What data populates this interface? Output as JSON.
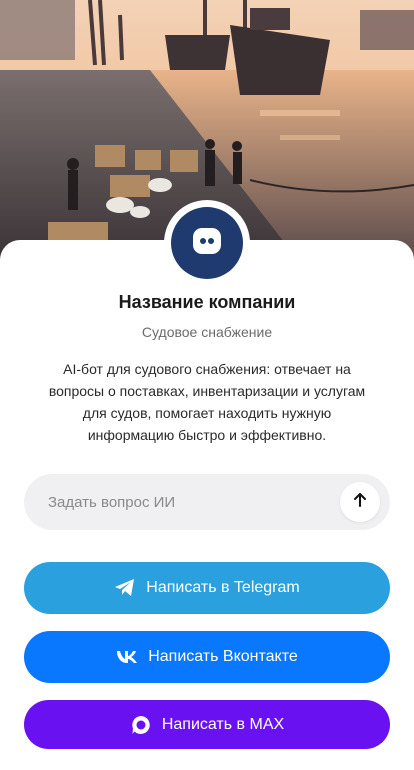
{
  "company": {
    "name": "Название компании",
    "category": "Судовое снабжение",
    "description": "AI-бот для судового снабжения: отвечает на вопросы о поставках, инвентаризации и услугам для судов, помогает находить нужную информацию быстро и эффективно."
  },
  "ask": {
    "placeholder": "Задать вопрос ИИ",
    "send_icon": "arrow-up-icon"
  },
  "buttons": {
    "telegram": {
      "label": "Написать в Telegram",
      "icon": "telegram-icon",
      "color": "#2aa0df"
    },
    "vk": {
      "label": "Написать Вконтакте",
      "icon": "vk-icon",
      "color": "#0a77ff"
    },
    "max": {
      "label": "Написать в MAX",
      "icon": "max-icon",
      "color": "#6a11f2"
    }
  },
  "avatar": {
    "icon": "chat-bot-icon",
    "color": "#1f3a6e"
  },
  "hero": {
    "image": "port-supply-illustration"
  }
}
